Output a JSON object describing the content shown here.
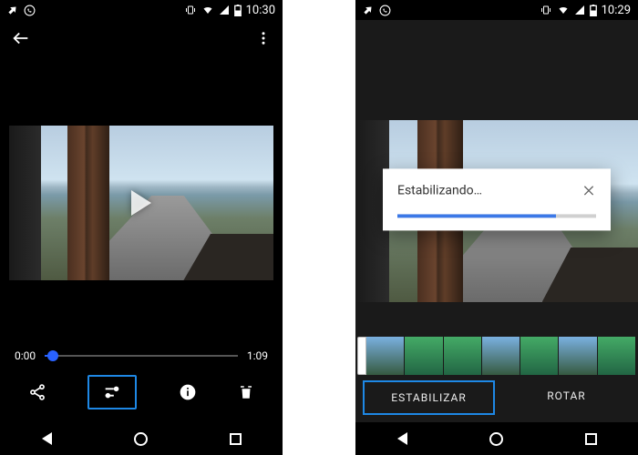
{
  "left": {
    "status": {
      "time": "10:30"
    },
    "player": {
      "current_time": "0:00",
      "duration": "1:09",
      "progress_pct": 4
    }
  },
  "right": {
    "status": {
      "time": "10:29"
    },
    "dialog": {
      "title": "Estabilizando…",
      "progress_pct": 80
    },
    "tabs": {
      "stabilize": "ESTABILIZAR",
      "rotate": "ROTAR"
    }
  }
}
